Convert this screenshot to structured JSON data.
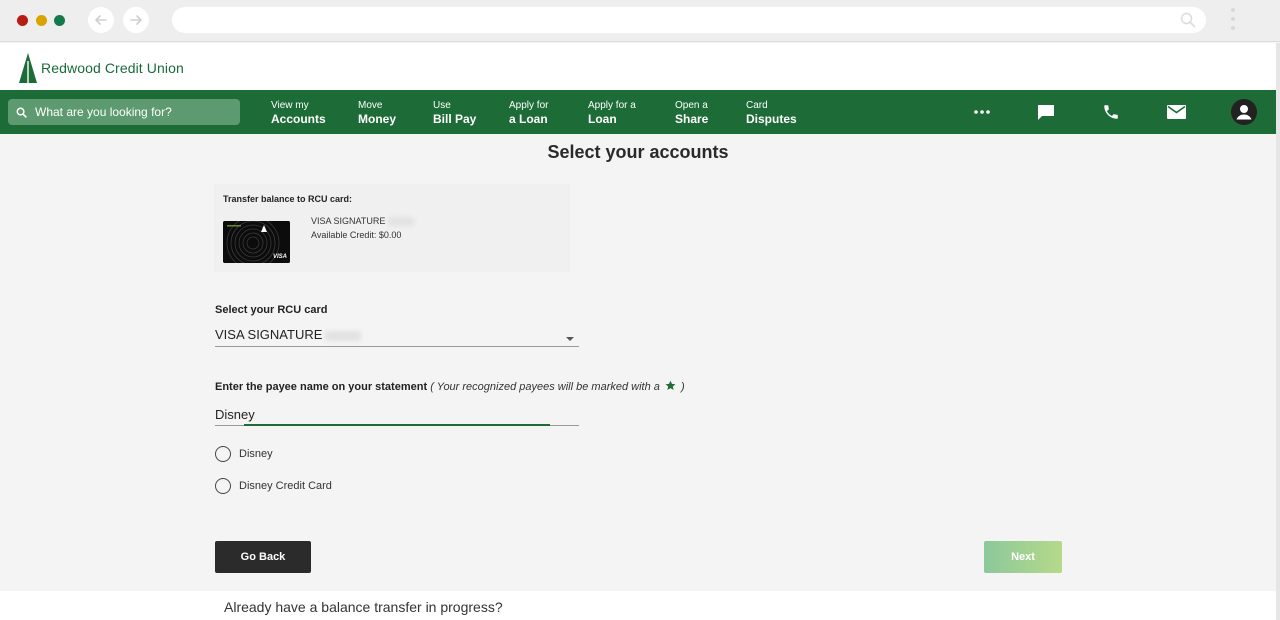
{
  "header": {
    "logo_text": "Redwood Credit Union"
  },
  "search": {
    "placeholder": "What are you looking for?"
  },
  "nav": {
    "items": [
      {
        "small": "View my",
        "big": "Accounts"
      },
      {
        "small": "Move",
        "big": "Money"
      },
      {
        "small": "Use",
        "big": "Bill Pay"
      },
      {
        "small": "Apply for",
        "big": "a Loan"
      },
      {
        "small": "Apply for a",
        "big": "Loan"
      },
      {
        "small": "Open a",
        "big": "Share"
      },
      {
        "small": "Card",
        "big": "Disputes"
      }
    ],
    "icons": [
      "more-icon",
      "chat-icon",
      "phone-icon",
      "mail-icon",
      "profile-icon"
    ]
  },
  "main": {
    "title": "Select your accounts",
    "transfer_card": {
      "title": "Transfer balance to RCU card:",
      "card_name": "VISA SIGNATURE",
      "available_credit": "Available Credit: $0.00",
      "card_brand": "VISA"
    },
    "select_card": {
      "label": "Select your RCU card",
      "value": "VISA SIGNATURE"
    },
    "payee": {
      "label": "Enter the payee name on your statement",
      "hint_before": "( Your recognized payees will be marked with a",
      "hint_after": ")",
      "value": "Disney"
    },
    "options": [
      {
        "label": "Disney"
      },
      {
        "label": "Disney Credit Card"
      }
    ],
    "buttons": {
      "back": "Go Back",
      "next": "Next"
    },
    "bottom_text": "Already have a balance transfer in progress?"
  },
  "colors": {
    "brand_green": "#1d6b37",
    "star_green": "#1d6b37"
  }
}
